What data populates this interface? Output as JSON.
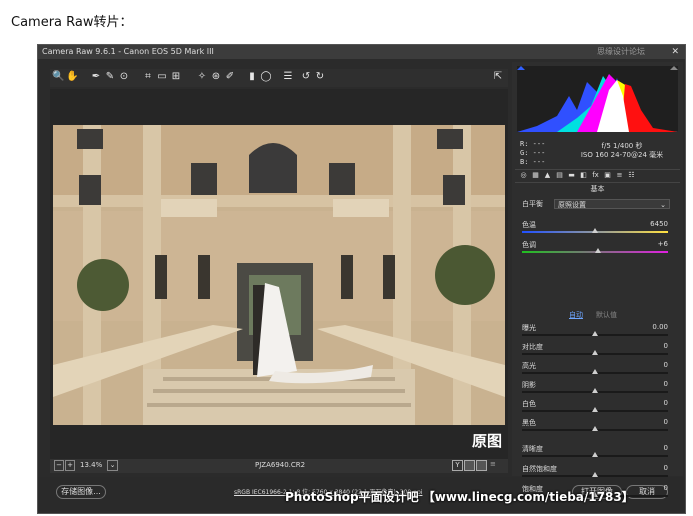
{
  "caption": "Camera Raw转片：",
  "window": {
    "title": "Camera Raw 9.6.1 - Canon EOS 5D Mark III",
    "watermark": "思缘设计论坛",
    "close_glyph": "✕"
  },
  "toolbar": {
    "tools": [
      "zoom-icon",
      "hand-icon",
      "white-balance-icon",
      "color-sampler-icon",
      "target-adjust-icon",
      "crop-icon",
      "straighten-icon",
      "transform-icon",
      "spot-removal-icon",
      "red-eye-icon",
      "adjustment-brush-icon",
      "graduated-filter-icon",
      "radial-filter-icon",
      "list-icon",
      "rotate-left-icon",
      "rotate-right-icon"
    ],
    "glyphs": [
      "🔍",
      "✋",
      "✒",
      "✎",
      "⊙",
      "⌗",
      "▭",
      "⊞",
      "✧",
      "⊛",
      "✐",
      "▮",
      "◯",
      "☰",
      "↺",
      "↻"
    ],
    "open_glyph": "⇱"
  },
  "photo": {
    "overlay_text": "原图"
  },
  "status": {
    "zoom": "13.4%",
    "filename": "PJZA6940.CR2",
    "minus": "−",
    "plus": "+",
    "view_y": "Y"
  },
  "bottom": {
    "save_label": "存储图像...",
    "link_text": "sRGB IEC61966-2.1; 8 位; 5760 x 3840 (22.1 百万像素); 300 ppi",
    "open_label": "打开图像",
    "cancel_label": "取消"
  },
  "rgb": {
    "r": "R:  ---",
    "g": "G:  ---",
    "b": "B:  ---"
  },
  "exif": {
    "line1": "f/5   1/400 秒",
    "line2": "ISO 160   24-70@24 毫米"
  },
  "panel": {
    "section_title": "基本",
    "wb_label": "白平衡",
    "wb_value": "原照设置",
    "temperature": {
      "label": "色温",
      "value": "6450",
      "pos": 0.5
    },
    "tint": {
      "label": "色调",
      "value": "+6",
      "pos": 0.52
    },
    "auto_label": "自动",
    "default_label": "默认值",
    "sliders": [
      {
        "label": "曝光",
        "value": "0.00",
        "pos": 0.5
      },
      {
        "label": "对比度",
        "value": "0",
        "pos": 0.5
      },
      {
        "label": "高光",
        "value": "0",
        "pos": 0.5
      },
      {
        "label": "阴影",
        "value": "0",
        "pos": 0.5
      },
      {
        "label": "白色",
        "value": "0",
        "pos": 0.5
      },
      {
        "label": "黑色",
        "value": "0",
        "pos": 0.5
      }
    ],
    "sliders2": [
      {
        "label": "清晰度",
        "value": "0",
        "pos": 0.5
      },
      {
        "label": "自然饱和度",
        "value": "0",
        "pos": 0.5
      },
      {
        "label": "饱和度",
        "value": "0",
        "pos": 0.5
      }
    ],
    "tabs": [
      "basic-icon",
      "tone-curve-icon",
      "detail-icon",
      "hsl-icon",
      "split-tone-icon",
      "lens-icon",
      "fx-icon",
      "camera-calibration-icon",
      "presets-icon",
      "snapshots-icon"
    ],
    "tab_glyphs": [
      "◎",
      "▦",
      "▲",
      "▤",
      "▬",
      "◧",
      "fx",
      "▣",
      "≡",
      "☷"
    ]
  },
  "watermark_text": "PhotoShop平面设计吧 【www.linecg.com/tieba/1783】"
}
